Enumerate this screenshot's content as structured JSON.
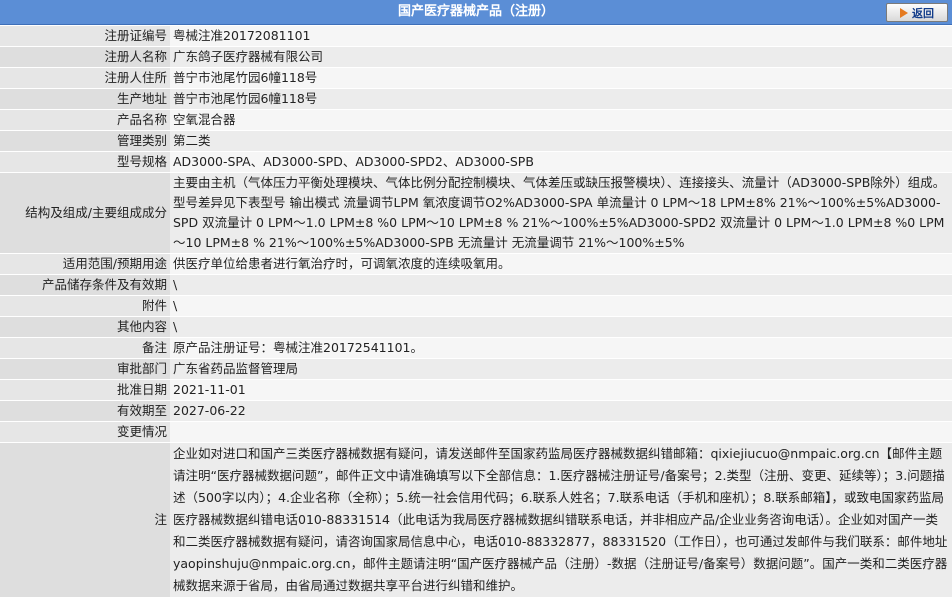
{
  "header": {
    "title": "国产医疗器械产品（注册）",
    "back_label": "返回"
  },
  "rows": [
    {
      "label": "注册证编号",
      "value": "粤械注准20172081101"
    },
    {
      "label": "注册人名称",
      "value": "广东鸽子医疗器械有限公司"
    },
    {
      "label": "注册人住所",
      "value": "普宁市池尾竹园6幢118号"
    },
    {
      "label": "生产地址",
      "value": "普宁市池尾竹园6幢118号"
    },
    {
      "label": "产品名称",
      "value": "空氧混合器"
    },
    {
      "label": "管理类别",
      "value": "第二类"
    },
    {
      "label": "型号规格",
      "value": "AD3000-SPA、AD3000-SPD、AD3000-SPD2、AD3000-SPB"
    },
    {
      "label": "结构及组成/主要组成成分",
      "value": "主要由主机（气体压力平衡处理模块、气体比例分配控制模块、气体差压或缺压报警模块）、连接接头、流量计（AD3000-SPB除外）组成。型号差异见下表型号 输出模式 流量调节LPM 氧浓度调节O2%AD3000-SPA 单流量计 0 LPM～18 LPM±8% 21%～100%±5%AD3000-SPD 双流量计 0 LPM～1.0 LPM±8 %0 LPM～10 LPM±8 % 21%～100%±5%AD3000-SPD2 双流量计 0 LPM～1.0 LPM±8 %0 LPM～10 LPM±8 % 21%～100%±5%AD3000-SPB 无流量计 无流量调节 21%～100%±5%"
    },
    {
      "label": "适用范围/预期用途",
      "value": "供医疗单位给患者进行氧治疗时，可调氧浓度的连续吸氧用。"
    },
    {
      "label": "产品储存条件及有效期",
      "value": "\\"
    },
    {
      "label": "附件",
      "value": "\\"
    },
    {
      "label": "其他内容",
      "value": "\\"
    },
    {
      "label": "备注",
      "value": "原产品注册证号：粤械注准20172541101。"
    },
    {
      "label": "审批部门",
      "value": "广东省药品监督管理局"
    },
    {
      "label": "批准日期",
      "value": "2021-11-01"
    },
    {
      "label": "有效期至",
      "value": "2027-06-22"
    },
    {
      "label": "变更情况",
      "value": ""
    }
  ],
  "note": {
    "label": "注",
    "text": "企业如对进口和国产三类医疗器械数据有疑问，请发送邮件至国家药监局医疗器械数据纠错邮箱：qixiejiucuo@nmpaic.org.cn【邮件主题请注明“医疗器械数据问题”，邮件正文中请准确填写以下全部信息：1.医疗器械注册证号/备案号；2.类型（注册、变更、延续等）；3.问题描述（500字以内）；4.企业名称（全称）；5.统一社会信用代码；6.联系人姓名；7.联系电话（手机和座机）；8.联系邮箱】，或致电国家药监局医疗器械数据纠错电话010-88331514（此电话为我局医疗器械数据纠错联系电话，并非相应产品/企业业务咨询电话）。企业如对国产一类和二类医疗器械数据有疑问，请咨询国家局信息中心，电话010-88332877，88331520（工作日），也可通过发邮件与我们联系：邮件地址yaopinshuju@nmpaic.org.cn，邮件主题请注明“国产医疗器械产品（注册）-数据（注册证号/备案号）数据问题”。国产一类和二类医疗器械数据来源于省局，由省局通过数据共享平台进行纠错和维护。"
  }
}
